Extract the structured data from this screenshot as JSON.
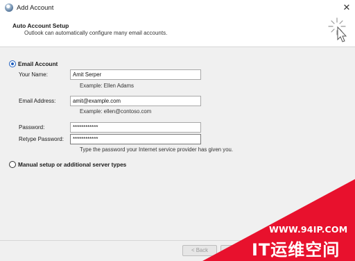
{
  "window": {
    "title": "Add Account",
    "close_glyph": "✕",
    "app_icon": "outlook-globe-icon"
  },
  "header": {
    "title": "Auto Account Setup",
    "subtitle": "Outlook can automatically configure many email accounts.",
    "icon": "wizard-sparkle-cursor-icon"
  },
  "email_account": {
    "label": "Email Account",
    "selected": true,
    "fields": {
      "name": {
        "label": "Your Name:",
        "value": "Amit Serper",
        "hint": "Example: Ellen Adams"
      },
      "email": {
        "label": "Email Address:",
        "value": "amit@example.com",
        "hint": "Example: ellen@contoso.com"
      },
      "password": {
        "label": "Password:",
        "value": "************"
      },
      "retype": {
        "label": "Retype Password:",
        "value": "************",
        "hint": "Type the password your Internet service provider has given you."
      }
    }
  },
  "manual_setup": {
    "label": "Manual setup or additional server types",
    "selected": false
  },
  "footer": {
    "back_label": "< Back"
  },
  "watermark": {
    "url": "WWW.94IP.COM",
    "text": "IT运维空间",
    "color": "#e8112d"
  }
}
